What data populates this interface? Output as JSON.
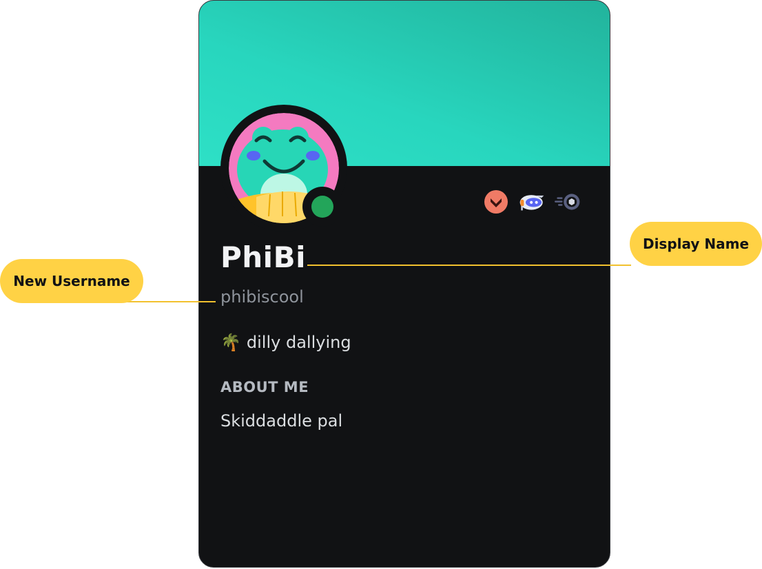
{
  "profile": {
    "display_name": "PhiBi",
    "username": "phibiscool",
    "custom_status": {
      "emoji": "🌴",
      "text": "dilly dallying"
    },
    "about_heading": "ABOUT ME",
    "about_text": "Skiddaddle pal",
    "status": "online",
    "badges": [
      "hypesquad-balance-icon",
      "quest-helmet-icon",
      "nitro-boost-icon"
    ],
    "avatar_icon": "frog-avatar"
  },
  "annotations": {
    "display_name_label": "Display Name",
    "username_label": "New Username"
  },
  "colors": {
    "banner": "#28d6be",
    "card_bg": "#111214",
    "status_online": "#23a55a",
    "callout": "#ffd245"
  }
}
